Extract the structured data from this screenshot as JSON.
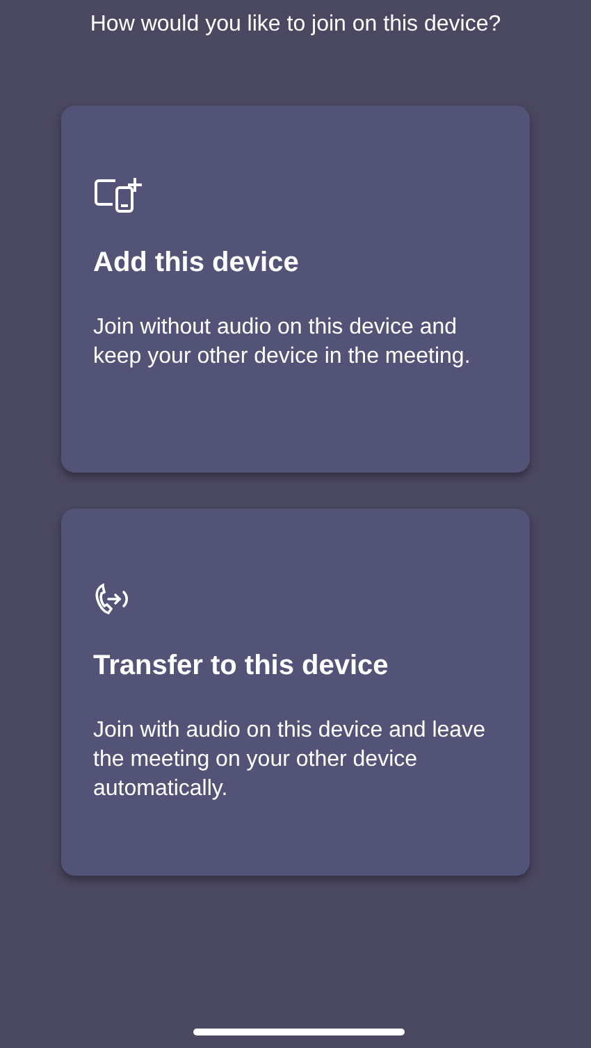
{
  "heading": "How would you like to join on this device?",
  "options": [
    {
      "kind": "add",
      "title": "Add this device",
      "description": "Join without audio on this device and keep your other device in the meeting."
    },
    {
      "kind": "transfer",
      "title": "Transfer to this device",
      "description": "Join with audio on this device and leave the meeting on your other device automatically."
    }
  ]
}
